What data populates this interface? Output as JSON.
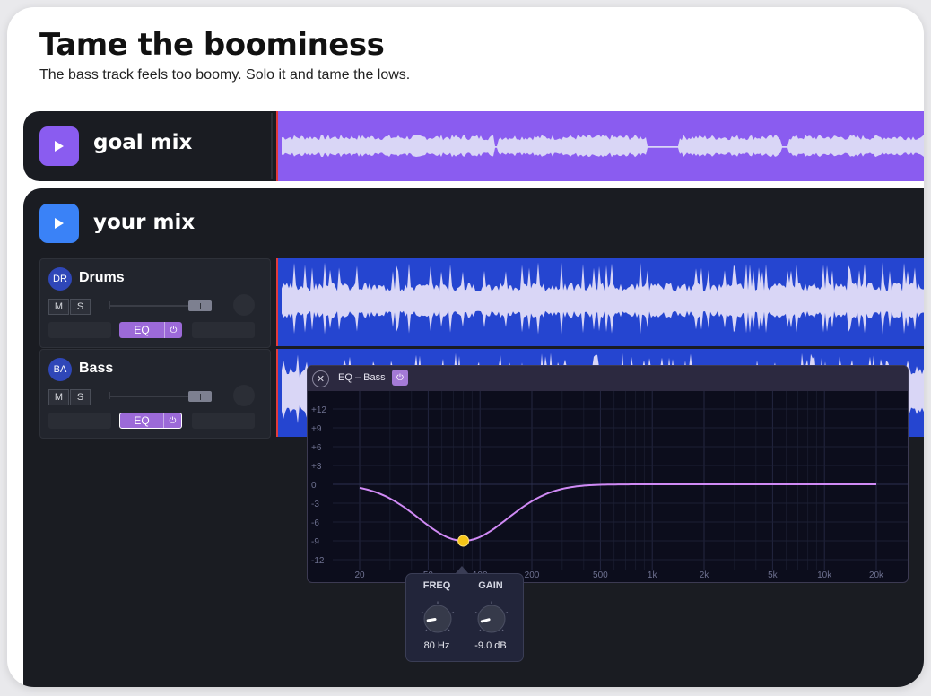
{
  "header": {
    "title": "Tame the boominess",
    "subtitle": "The bass track feels too boomy. Solo it and tame the lows."
  },
  "goal_mix": {
    "label": "goal mix",
    "color": "#8a5cf0",
    "wave_color": "#dcd3f5"
  },
  "your_mix": {
    "label": "your mix",
    "play_color": "#3a82f7",
    "tracks": [
      {
        "avatar": "DR",
        "name": "Drums",
        "mute_label": "M",
        "solo_label": "S",
        "eq_label": "EQ",
        "eq_power_icon": "power-icon",
        "eq_active": false,
        "fader_level": 0.9
      },
      {
        "avatar": "BA",
        "name": "Bass",
        "mute_label": "M",
        "solo_label": "S",
        "eq_label": "EQ",
        "eq_power_icon": "power-icon",
        "eq_active": true,
        "fader_level": 0.9
      }
    ],
    "wave_color": "#2545d0",
    "playhead_color": "#e23b3b"
  },
  "eq_panel": {
    "title": "EQ – Bass",
    "close_icon": "close-icon",
    "power_icon": "power-icon",
    "db_labels": [
      "+12",
      "+9",
      "+6",
      "+3",
      "0",
      "-3",
      "-6",
      "-9",
      "-12"
    ],
    "freq_labels": [
      "20",
      "50",
      "100",
      "200",
      "500",
      "1k",
      "2k",
      "5k",
      "10k",
      "20k"
    ],
    "band": {
      "freq_hz": 80,
      "gain_db": -9.0
    },
    "curve_color": "#d08af5",
    "node_color": "#f5c518"
  },
  "knob_popup": {
    "freq": {
      "label": "FREQ",
      "value": "80 Hz",
      "rotation": -100
    },
    "gain": {
      "label": "GAIN",
      "value": "-9.0 dB",
      "rotation": -105
    }
  }
}
